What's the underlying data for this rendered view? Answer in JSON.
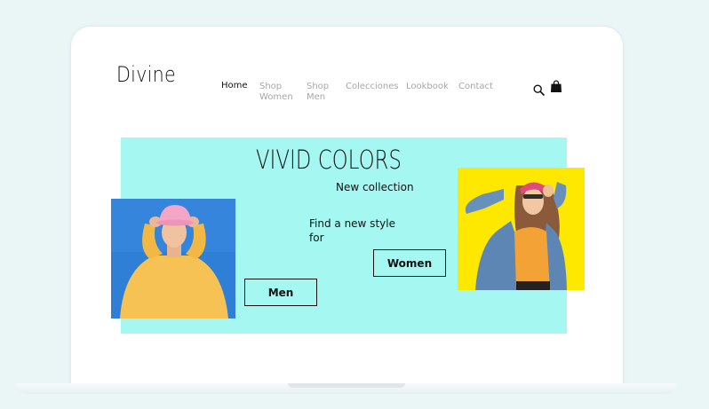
{
  "brand": {
    "logo": "Divine"
  },
  "nav": {
    "home": "Home",
    "shop_women": [
      "Shop",
      "Women"
    ],
    "shop_men": [
      "Shop",
      "Men"
    ],
    "collections": "Colecciones",
    "lookbook": "Lookbook",
    "contact": "Contact"
  },
  "header_icons": [
    "search-icon",
    "shopping-bag-icon"
  ],
  "hero": {
    "title": "VIVID COLORS",
    "subtitle": "New collection",
    "tagline_line1": "Find a new style",
    "tagline_line2": "for",
    "women_button": "Women",
    "men_button": "Men",
    "images": [
      "man-in-yellow-sweater-pink-cap",
      "woman-in-denim-jacket-on-yellow"
    ]
  },
  "colors": {
    "hero_background": "#a5f7f2",
    "men_photo_background": "#2f7fd6",
    "women_photo_background": "#ffe800",
    "page_background": "#eaf5f6"
  }
}
